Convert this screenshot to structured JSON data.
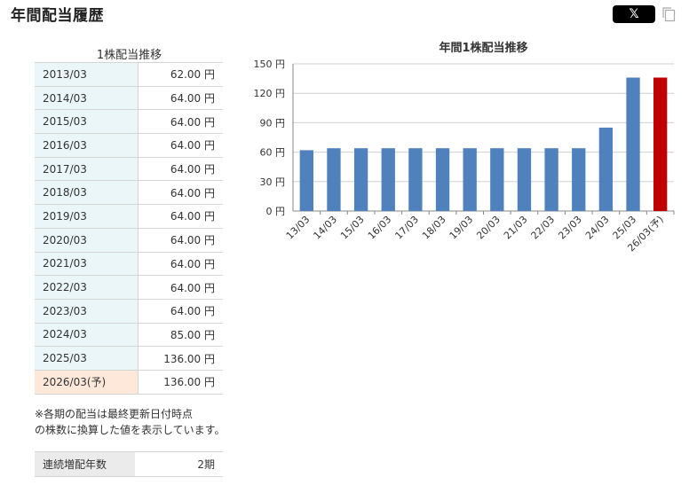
{
  "page_title": "年間配当履歴",
  "share_button_label": "𝕏",
  "table": {
    "caption": "1株配当推移",
    "unit": "円",
    "rows": [
      {
        "period": "2013/03",
        "value": "62.00"
      },
      {
        "period": "2014/03",
        "value": "64.00"
      },
      {
        "period": "2015/03",
        "value": "64.00"
      },
      {
        "period": "2016/03",
        "value": "64.00"
      },
      {
        "period": "2017/03",
        "value": "64.00"
      },
      {
        "period": "2018/03",
        "value": "64.00"
      },
      {
        "period": "2019/03",
        "value": "64.00"
      },
      {
        "period": "2020/03",
        "value": "64.00"
      },
      {
        "period": "2021/03",
        "value": "64.00"
      },
      {
        "period": "2022/03",
        "value": "64.00"
      },
      {
        "period": "2023/03",
        "value": "64.00"
      },
      {
        "period": "2024/03",
        "value": "85.00"
      },
      {
        "period": "2025/03",
        "value": "136.00"
      },
      {
        "period": "2026/03(予)",
        "value": "136.00",
        "forecast": true
      }
    ]
  },
  "note_lines": [
    "※各期の配当は最終更新日付時点",
    "の株数に換算した値を表示しています。"
  ],
  "streak": {
    "label": "連続増配年数",
    "value": "2期"
  },
  "colors": {
    "bar": "#4f81bd",
    "forecast_bar": "#c00000",
    "year_cell": "#eaf6f7",
    "forecast_cell": "#fde8da"
  },
  "icons": [
    "x-logo-icon",
    "copy-icon"
  ],
  "chart_data": {
    "type": "bar",
    "title": "年間1株配当推移",
    "categories": [
      "13/03",
      "14/03",
      "15/03",
      "16/03",
      "17/03",
      "18/03",
      "19/03",
      "20/03",
      "21/03",
      "22/03",
      "23/03",
      "24/03",
      "25/03",
      "26/03(予)"
    ],
    "values": [
      62,
      64,
      64,
      64,
      64,
      64,
      64,
      64,
      64,
      64,
      64,
      85,
      136,
      136
    ],
    "forecast_index": 13,
    "ylim": [
      0,
      150
    ],
    "yticks": [
      0,
      30,
      60,
      90,
      120,
      150
    ],
    "ytick_suffix": " 円",
    "grid": true,
    "legend": false
  }
}
